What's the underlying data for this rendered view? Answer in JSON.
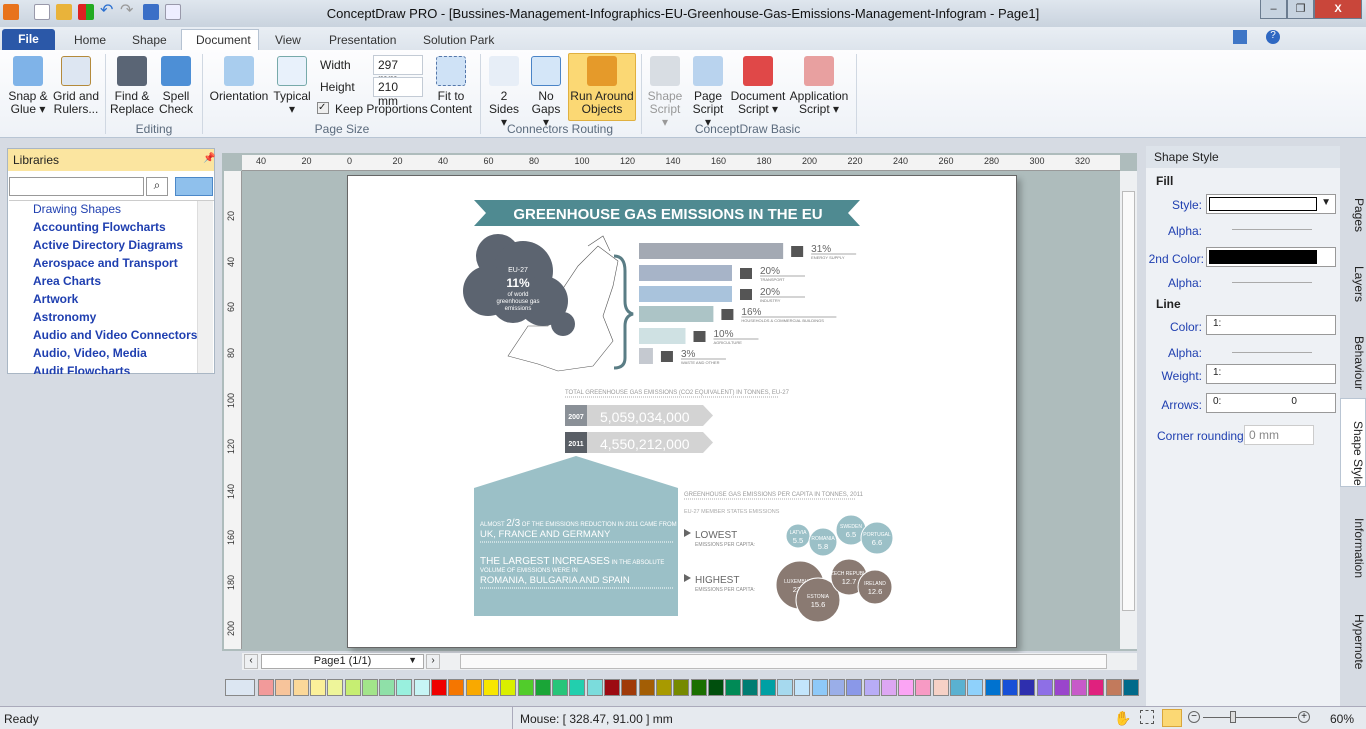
{
  "window": {
    "title": "ConceptDraw PRO - [Bussines-Management-Infographics-EU-Greenhouse-Gas-Emissions-Management-Infogram - Page1]",
    "minimize": "–",
    "maximize": "❐",
    "close": "X"
  },
  "menu": {
    "file": "File",
    "tabs": [
      "Home",
      "Shape",
      "Document",
      "View",
      "Presentation",
      "Solution Park"
    ],
    "active": "Document"
  },
  "ribbon": {
    "snap": "Snap &",
    "snap2": "Glue ▾",
    "grid": "Grid and",
    "grid2": "Rulers...",
    "find": "Find &",
    "find2": "Replace",
    "spell": "Spell",
    "spell2": "Check",
    "editing": "Editing",
    "orientation": "Orientation",
    "typical": "Typical",
    "typical2": "▾",
    "width_label": "Width",
    "width_value": "297 mm",
    "height_label": "Height",
    "height_value": "210 mm",
    "keep": "Keep Proportions",
    "fit": "Fit to",
    "fit2": "Content",
    "page_size": "Page Size",
    "sides": "2 Sides",
    "sides2": "▾",
    "gaps": "No",
    "gaps2": "Gaps ▾",
    "run": "Run Around",
    "run2": "Objects",
    "connectors": "Connectors Routing",
    "shape_script": "Shape",
    "shape_script2": "Script ▾",
    "page_script": "Page",
    "page_script2": "Script ▾",
    "doc_script": "Document",
    "doc_script2": "Script ▾",
    "app_script": "Application",
    "app_script2": "Script ▾",
    "basic": "ConceptDraw Basic"
  },
  "libraries": {
    "title": "Libraries",
    "search_placeholder": "",
    "items": [
      "Drawing Shapes",
      "Accounting Flowcharts",
      "Active Directory Diagrams",
      "Aerospace and Transport",
      "Area Charts",
      "Artwork",
      "Astronomy",
      "Audio and Video Connectors",
      "Audio, Video, Media",
      "Audit Flowcharts"
    ]
  },
  "rulers": {
    "top": [
      "40",
      "20",
      "0",
      "20",
      "40",
      "60",
      "80",
      "100",
      "120",
      "140",
      "160",
      "180",
      "200",
      "220",
      "240",
      "260",
      "280",
      "300",
      "320"
    ],
    "left": [
      "20",
      "40",
      "60",
      "80",
      "100",
      "120",
      "140",
      "160",
      "180",
      "200"
    ]
  },
  "infographic": {
    "title": "GREENHOUSE GAS EMISSIONS IN THE EU",
    "cloud": {
      "line1": "EU-27",
      "line2": "11%",
      "line3": "of world",
      "line4": "greenhouse gas",
      "line5": "emissions"
    },
    "sectors": [
      {
        "pct": "31%",
        "label": "ENERGY SUPPLY",
        "value": 31,
        "color": "#a3a9b3"
      },
      {
        "pct": "20%",
        "label": "TRANSPORT",
        "value": 20,
        "color": "#a7b4c8"
      },
      {
        "pct": "20%",
        "label": "INDUSTRY",
        "value": 20,
        "color": "#a9c3dc"
      },
      {
        "pct": "16%",
        "label": "HOUSEHOLDS & COMMERCIAL BUILDINGS",
        "value": 16,
        "color": "#acc4c6"
      },
      {
        "pct": "10%",
        "label": "AGRICULTURE",
        "value": 10,
        "color": "#cfe1e3"
      },
      {
        "pct": "3%",
        "label": "WASTE AND OTHER",
        "value": 3,
        "color": "#c5c9d0"
      }
    ],
    "totals_title": "TOTAL GREENHOUSE GAS EMISSIONS (CO2 EQUIVALENT) IN TONNES, EU-27",
    "totals": [
      {
        "year": "2007",
        "value": "5,059,034,000"
      },
      {
        "year": "2011",
        "value": "4,550,212,000"
      }
    ],
    "house": {
      "a1": "ALMOST ",
      "a2": "2/3",
      "a3": " OF THE EMISSIONS REDUCTION IN 2011 CAME FROM",
      "a4": "UK, FRANCE AND GERMANY",
      "b1": "THE LARGEST INCREASES",
      "b2": " IN THE ABSOLUTE",
      "b3": "VOLUME OF EMISSIONS WERE IN",
      "b4": "ROMANIA, BULGARIA AND SPAIN"
    },
    "per_capita_title": "GREENHOUSE GAS EMISSIONS PER CAPITA IN TONNES, 2011",
    "member_states": "EU-27 MEMBER STATES EMISSIONS",
    "lowest": "LOWEST",
    "highest": "HIGHEST",
    "per_capita": "EMISSIONS PER CAPITA:",
    "low": [
      {
        "name": "LATVIA",
        "value": "5.5"
      },
      {
        "name": "ROMANIA",
        "value": "5.8"
      },
      {
        "name": "SWEDEN",
        "value": "6.5"
      },
      {
        "name": "PORTUGAL",
        "value": "6.6"
      }
    ],
    "high": [
      {
        "name": "LUXEMBURG",
        "value": "23.6"
      },
      {
        "name": "ESTONIA",
        "value": "15.6"
      },
      {
        "name": "CZECH REPUBLIC",
        "value": "12.7"
      },
      {
        "name": "IRELAND",
        "value": "12.6"
      }
    ]
  },
  "nav": {
    "page": "Page1 (1/1)"
  },
  "palette": [
    "#f29a9a",
    "#f7c49b",
    "#fbd899",
    "#fbf09a",
    "#eef59a",
    "#c6ee72",
    "#a2e48a",
    "#8fe0a8",
    "#99f0de",
    "#c7f5f5",
    "#ef0000",
    "#f57600",
    "#f9a900",
    "#f8e600",
    "#d9ef00",
    "#51cc2b",
    "#1aa537",
    "#27c57a",
    "#22cfae",
    "#7bdcdc",
    "#9c0a12",
    "#a03a0a",
    "#a35e05",
    "#a89a00",
    "#768a00",
    "#1a6f00",
    "#004f0d",
    "#008a56",
    "#007d73",
    "#00a0a4",
    "#a6d9ee",
    "#c3e5fb",
    "#8ec9f8",
    "#9aaee8",
    "#8a98e8",
    "#b8acf6",
    "#dda7f3",
    "#fba4f4",
    "#f79ac4",
    "#f6d1c6",
    "#5ab1d1",
    "#8fd1fb",
    "#0072cf",
    "#1750d7",
    "#2e2fae",
    "#8e6fe6",
    "#9a45cc",
    "#c75ac9",
    "#e0217e",
    "#c27a5c",
    "#006a8a"
  ],
  "status": {
    "ready": "Ready",
    "mouse": "Mouse: [ 328.47, 91.00 ] mm",
    "zoom": "60%"
  },
  "shape_style": {
    "title": "Shape Style",
    "fill": "Fill",
    "style": "Style:",
    "alpha": "Alpha:",
    "second": "2nd Color:",
    "line": "Line",
    "color": "Color:",
    "color_val": "1:",
    "weight": "Weight:",
    "weight_val": "1:",
    "arrows": "Arrows:",
    "arrows_val": "0:",
    "arrows_end": "0",
    "corner": "Corner rounding:",
    "corner_val": "0 mm"
  },
  "side_tabs": [
    "Pages",
    "Layers",
    "Behaviour",
    "Shape Style",
    "Information",
    "Hypernote"
  ]
}
